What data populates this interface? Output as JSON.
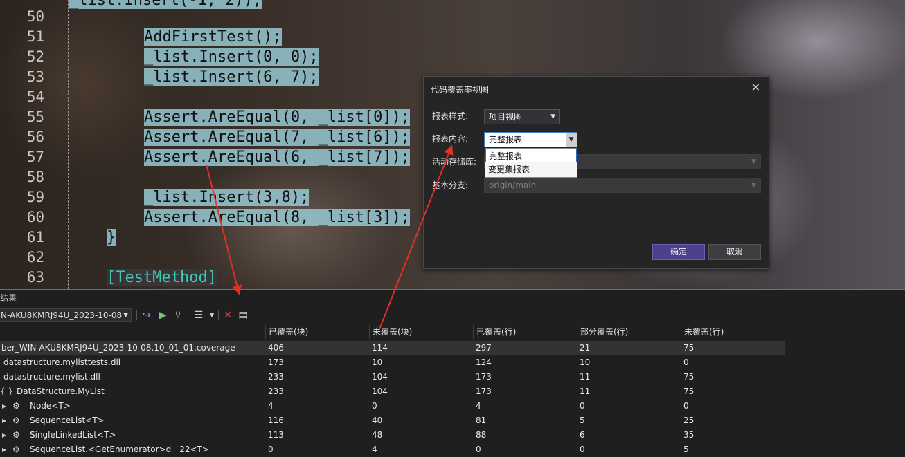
{
  "editor": {
    "lines": [
      {
        "num": "50",
        "code": ""
      },
      {
        "num": "51",
        "code": "AddFirstTest();"
      },
      {
        "num": "52",
        "code": "_list.Insert(0, 0);"
      },
      {
        "num": "53",
        "code": "_list.Insert(6, 7);"
      },
      {
        "num": "54",
        "code": ""
      },
      {
        "num": "55",
        "code": "Assert.AreEqual(0, _list[0]);"
      },
      {
        "num": "56",
        "code": "Assert.AreEqual(7, _list[6]);"
      },
      {
        "num": "57",
        "code": "Assert.AreEqual(6, _list[7]);"
      },
      {
        "num": "58",
        "code": ""
      },
      {
        "num": "59",
        "code": "_list.Insert(3,8);"
      },
      {
        "num": "60",
        "code": "Assert.AreEqual(8, _list[3]);"
      },
      {
        "num": "61",
        "code": "}"
      },
      {
        "num": "62",
        "code": ""
      },
      {
        "num": "63",
        "code": "[TestMethod]"
      }
    ],
    "partial_top_line": "_list.Insert(-1, 2));"
  },
  "dialog": {
    "title": "代码覆盖率视图",
    "close_glyph": "✕",
    "report_style_label": "报表样式:",
    "report_style_value": "项目视图",
    "report_content_label": "报表内容:",
    "report_content_value": "完整报表",
    "active_repo_label": "活动存储库:",
    "base_branch_label": "基本分支:",
    "base_branch_value": "origin/main",
    "dropdown_options": [
      "完整报表",
      "变更集报表"
    ],
    "ok_label": "确定",
    "cancel_label": "取消"
  },
  "panel": {
    "title": "结果",
    "run_selector": "N-AKU8KMRJ94U_2023-10-08",
    "columns": [
      "已覆盖(块)",
      "未覆盖(块)",
      "已覆盖(行)",
      "部分覆盖(行)",
      "未覆盖(行)"
    ],
    "rows": [
      {
        "name": "ber_WIN-AKU8KMRJ94U_2023-10-08.10_01_01.coverage",
        "v": [
          "406",
          "114",
          "297",
          "21",
          "75"
        ],
        "selected": true,
        "kind": "root"
      },
      {
        "name": "datastructure.mylisttests.dll",
        "v": [
          "173",
          "10",
          "124",
          "10",
          "0"
        ],
        "kind": "dll"
      },
      {
        "name": "datastructure.mylist.dll",
        "v": [
          "233",
          "104",
          "173",
          "11",
          "75"
        ],
        "kind": "dll"
      },
      {
        "name": "DataStructure.MyList",
        "v": [
          "233",
          "104",
          "173",
          "11",
          "75"
        ],
        "kind": "ns"
      },
      {
        "name": "Node<T>",
        "v": [
          "4",
          "0",
          "4",
          "0",
          "0"
        ],
        "kind": "class"
      },
      {
        "name": "SequenceList<T>",
        "v": [
          "116",
          "40",
          "81",
          "5",
          "25"
        ],
        "kind": "class"
      },
      {
        "name": "SingleLinkedList<T>",
        "v": [
          "113",
          "48",
          "88",
          "6",
          "35"
        ],
        "kind": "class"
      },
      {
        "name": "SequenceList.<GetEnumerator>d__22<T>",
        "v": [
          "0",
          "4",
          "0",
          "0",
          "5"
        ],
        "kind": "class"
      }
    ]
  },
  "colors": {
    "accent": "#7160c8",
    "primary_button": "#4b3f8e",
    "arrow": "#e0302a"
  }
}
